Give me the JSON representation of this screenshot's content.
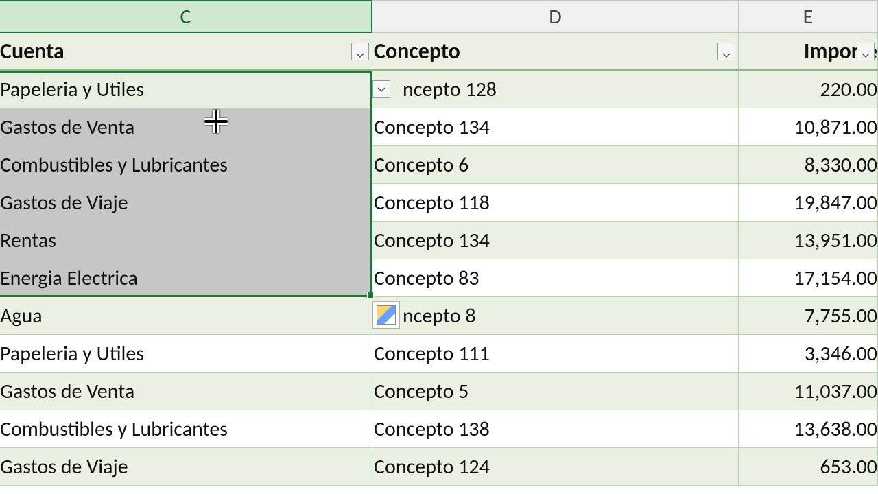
{
  "columns": {
    "C": "C",
    "D": "D",
    "E": "E"
  },
  "headers": {
    "cuenta": "Cuenta",
    "concepto": "Concepto",
    "importe": "Importe"
  },
  "rows": [
    {
      "cuenta": "Papeleria y Utiles",
      "concepto_full": "Concepto 128",
      "concepto_disp": "ncepto 128",
      "importe": "220.00"
    },
    {
      "cuenta": "Gastos de Venta",
      "concepto_full": "Concepto 134",
      "concepto_disp": "Concepto 134",
      "importe": "10,871.00"
    },
    {
      "cuenta": "Combustibles y Lubricantes",
      "concepto_full": "Concepto 6",
      "concepto_disp": "Concepto 6",
      "importe": "8,330.00"
    },
    {
      "cuenta": "Gastos de Viaje",
      "concepto_full": "Concepto 118",
      "concepto_disp": "Concepto 118",
      "importe": "19,847.00"
    },
    {
      "cuenta": "Rentas",
      "concepto_full": "Concepto 134",
      "concepto_disp": "Concepto 134",
      "importe": "13,951.00"
    },
    {
      "cuenta": "Energia Electrica",
      "concepto_full": "Concepto 83",
      "concepto_disp": "Concepto 83",
      "importe": "17,154.00"
    },
    {
      "cuenta": "Agua",
      "concepto_full": "Concepto 8",
      "concepto_disp": "ncepto 8",
      "importe": "7,755.00"
    },
    {
      "cuenta": "Papeleria y Utiles",
      "concepto_full": "Concepto 111",
      "concepto_disp": "Concepto 111",
      "importe": "3,346.00"
    },
    {
      "cuenta": "Gastos de Venta",
      "concepto_full": "Concepto 5",
      "concepto_disp": "Concepto 5",
      "importe": "11,037.00"
    },
    {
      "cuenta": "Combustibles y Lubricantes",
      "concepto_full": "Concepto 138",
      "concepto_disp": "Concepto 138",
      "importe": "13,638.00"
    },
    {
      "cuenta": "Gastos de Viaje",
      "concepto_full": "Concepto 124",
      "concepto_disp": "Concepto 124",
      "importe": "653.00"
    }
  ],
  "banded_indices": [
    0,
    2,
    4,
    6,
    8,
    10
  ],
  "selection": {
    "top_row": 0,
    "bottom_row": 5,
    "shaded_rows": [
      1,
      2,
      3,
      4,
      5
    ]
  },
  "has_incell_dropdown_row": 0,
  "has_qa_icon_near_row": 6
}
